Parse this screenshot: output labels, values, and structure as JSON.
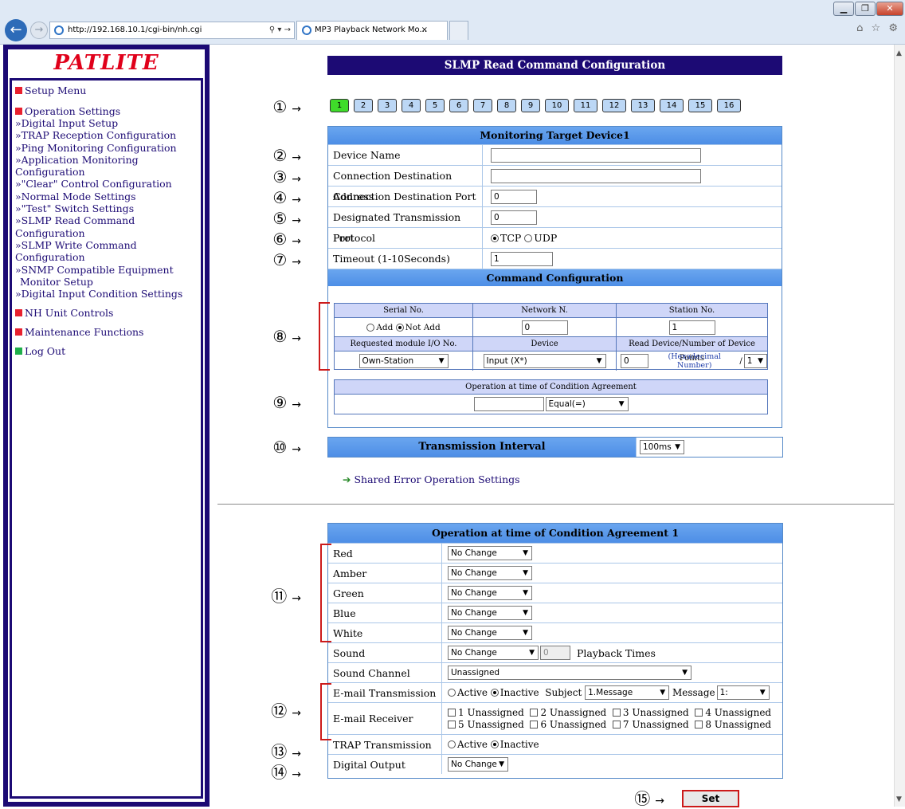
{
  "browser": {
    "url": "http://192.168.10.1/cgi-bin/nh.cgi",
    "tab_title": "MP3 Playback Network Mo...",
    "address_tools": "⚲ ▾ →",
    "tab_close": "×",
    "right_icons": "⌂ ☆ ⚙",
    "min": "▁",
    "max": "❐",
    "close": "✕"
  },
  "sidebar": {
    "logo": "PATLITE",
    "setup_menu": "Setup Menu",
    "operation_settings": "Operation Settings",
    "items": [
      "»Digital Input Setup",
      "»TRAP Reception Configuration",
      "»Ping Monitoring Configuration",
      "»Application Monitoring Configuration",
      "»\"Clear\" Control Configuration",
      "»Normal Mode Settings",
      "»\"Test\" Switch Settings",
      "»SLMP Read Command Configuration",
      "»SLMP Write Command Configuration",
      "»SNMP Compatible Equipment",
      "Monitor Setup",
      "»Digital Input Condition Settings"
    ],
    "nh_unit": "NH Unit Controls",
    "maintenance": "Maintenance Functions",
    "logout": "Log Out"
  },
  "page": {
    "title": "SLMP Read Command Configuration",
    "device_tabs": [
      "1",
      "2",
      "3",
      "4",
      "5",
      "6",
      "7",
      "8",
      "9",
      "10",
      "11",
      "12",
      "13",
      "14",
      "15",
      "16"
    ],
    "active_tab": "1",
    "markers": [
      "①",
      "②",
      "③",
      "④",
      "⑤",
      "⑥",
      "⑦",
      "⑧",
      "⑨",
      "⑩",
      "⑪",
      "⑫",
      "⑬",
      "⑭",
      "⑮"
    ],
    "arrow": "→"
  },
  "monitor": {
    "header": "Monitoring Target Device1",
    "device_name_label": "Device Name",
    "device_name_value": "",
    "conn_addr_label": "Connection Destination Address",
    "conn_addr_value": "",
    "conn_port_label": "Connection Destination Port",
    "conn_port_value": "0",
    "tx_port_label": "Designated Transmission Port",
    "tx_port_value": "0",
    "protocol_label": "Protocol",
    "protocol_tcp": "TCP",
    "protocol_udp": "UDP",
    "timeout_label": "Timeout (1-10Seconds)",
    "timeout_value": "1"
  },
  "command": {
    "header": "Command Configuration",
    "serial_h": "Serial No.",
    "network_h": "Network N.",
    "station_h": "Station No.",
    "add": "Add",
    "not_add": "Not Add",
    "network_value": "0",
    "station_value": "1",
    "module_h": "Requested module I/O No.",
    "device_h": "Device",
    "read_h": "Read Device/Number of Device Points",
    "module_value": "Own-Station",
    "device_value": "Input (X*)",
    "read_value": "0",
    "hex_note": "(Hexadecimal Number)",
    "slash": "/",
    "points_value": "1",
    "op_h": "Operation at time of Condition Agreement",
    "op_value": "",
    "op_select": "Equal(=)"
  },
  "interval": {
    "label": "Transmission Interval",
    "value": "100ms"
  },
  "shared_link": "Shared Error Operation Settings",
  "agreement": {
    "header": "Operation at time of Condition Agreement 1",
    "red": "Red",
    "amber": "Amber",
    "green": "Green",
    "blue": "Blue",
    "white": "White",
    "no_change": "No Change",
    "sound": "Sound",
    "sound_times": "0",
    "playback_times": "Playback Times",
    "sound_channel": "Sound Channel",
    "sound_channel_value": "Unassigned",
    "email_tx": "E-mail Transmission",
    "active": "Active",
    "inactive": "Inactive",
    "subject": "Subject",
    "subject_value": "1.Message",
    "message": "Message",
    "message_value": "1:",
    "email_rx": "E-mail Receiver",
    "receivers": [
      "1 Unassigned",
      "2 Unassigned",
      "3 Unassigned",
      "4 Unassigned",
      "5 Unassigned",
      "6 Unassigned",
      "7 Unassigned",
      "8 Unassigned"
    ],
    "trap_tx": "TRAP Transmission",
    "digital_out": "Digital Output",
    "digital_out_value": "No Change"
  },
  "set_button": "Set"
}
